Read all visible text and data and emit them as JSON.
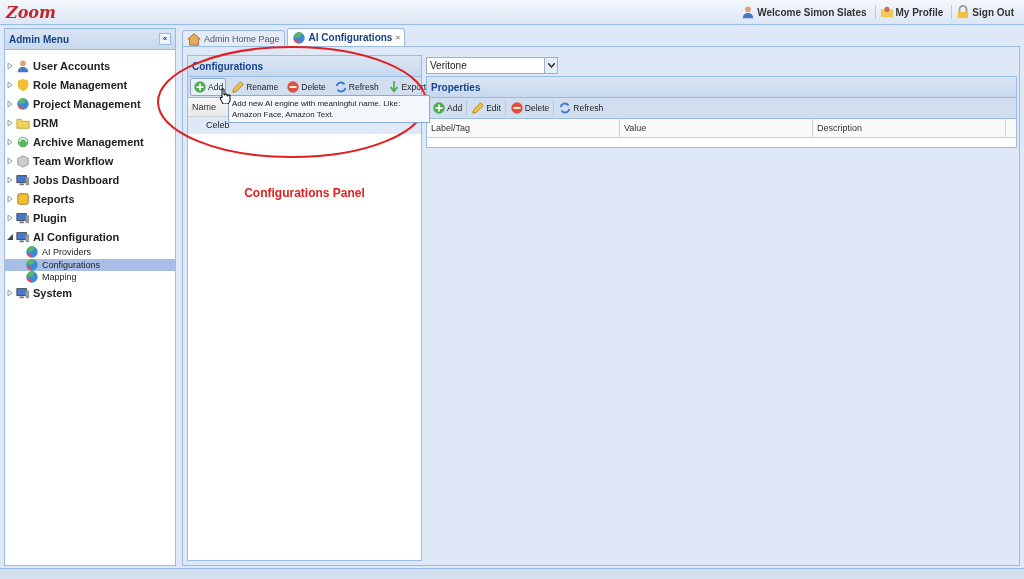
{
  "header": {
    "logo": "Zoom",
    "links": [
      {
        "kind": "user",
        "label": "Welcome Simon Slates"
      },
      {
        "kind": "profile",
        "label": "My Profile"
      },
      {
        "kind": "lock",
        "label": "Sign Out"
      }
    ]
  },
  "sidebar": {
    "title": "Admin Menu",
    "collapse": "«",
    "items": [
      {
        "kind": "user",
        "label": "User Accounts",
        "expanded": false,
        "selected": false
      },
      {
        "kind": "shield",
        "label": "Role Management",
        "expanded": false,
        "selected": false
      },
      {
        "kind": "globe",
        "label": "Project Management",
        "expanded": false,
        "selected": false
      },
      {
        "kind": "folder",
        "label": "DRM",
        "expanded": false,
        "selected": false
      },
      {
        "kind": "archive",
        "label": "Archive Management",
        "expanded": false,
        "selected": false
      },
      {
        "kind": "box",
        "label": "Team Workflow",
        "expanded": false,
        "selected": false
      },
      {
        "kind": "monitor",
        "label": "Jobs Dashboard",
        "expanded": false,
        "selected": false
      },
      {
        "kind": "report",
        "label": "Reports",
        "expanded": false,
        "selected": false
      },
      {
        "kind": "monitor",
        "label": "Plugin",
        "expanded": false,
        "selected": false
      },
      {
        "kind": "monitor",
        "label": "AI Configuration",
        "expanded": true,
        "selected": false,
        "children": [
          {
            "kind": "globe",
            "label": "AI Providers",
            "selected": false
          },
          {
            "kind": "globe",
            "label": "Configurations",
            "selected": true
          },
          {
            "kind": "globe",
            "label": "Mapping",
            "selected": false
          }
        ]
      },
      {
        "kind": "monitor",
        "label": "System",
        "expanded": false,
        "selected": false
      }
    ]
  },
  "tabs": [
    {
      "kind": "home",
      "label": "Admin Home Page",
      "selected": false
    },
    {
      "kind": "globe",
      "label": "AI Configurations",
      "selected": true,
      "close": "×"
    }
  ],
  "configurations": {
    "title": "Configurations",
    "toolbar": [
      {
        "kind": "add",
        "label": "Add"
      },
      {
        "kind": "edit",
        "label": "Rename"
      },
      {
        "kind": "delete",
        "label": "Delete"
      },
      {
        "kind": "refresh",
        "label": "Refresh"
      },
      {
        "kind": "export",
        "label": "Export"
      }
    ],
    "columns": [
      "Name"
    ],
    "rows": [
      {
        "cells": [
          "Celeb"
        ],
        "selected": true
      }
    ],
    "tooltip": "Add new AI engine with meaningful name. Like: Amazon Face, Amazon Text."
  },
  "annotation": {
    "label": "Configurations Panel"
  },
  "properties": {
    "engine": "Veritone",
    "title": "Properties",
    "toolbar": [
      {
        "kind": "add",
        "label": "Add"
      },
      {
        "kind": "edit",
        "label": "Edit"
      },
      {
        "kind": "delete",
        "label": "Delete"
      },
      {
        "kind": "refresh",
        "label": "Refresh"
      }
    ],
    "columns": [
      "Label/Tag",
      "Value",
      "Description"
    ]
  }
}
